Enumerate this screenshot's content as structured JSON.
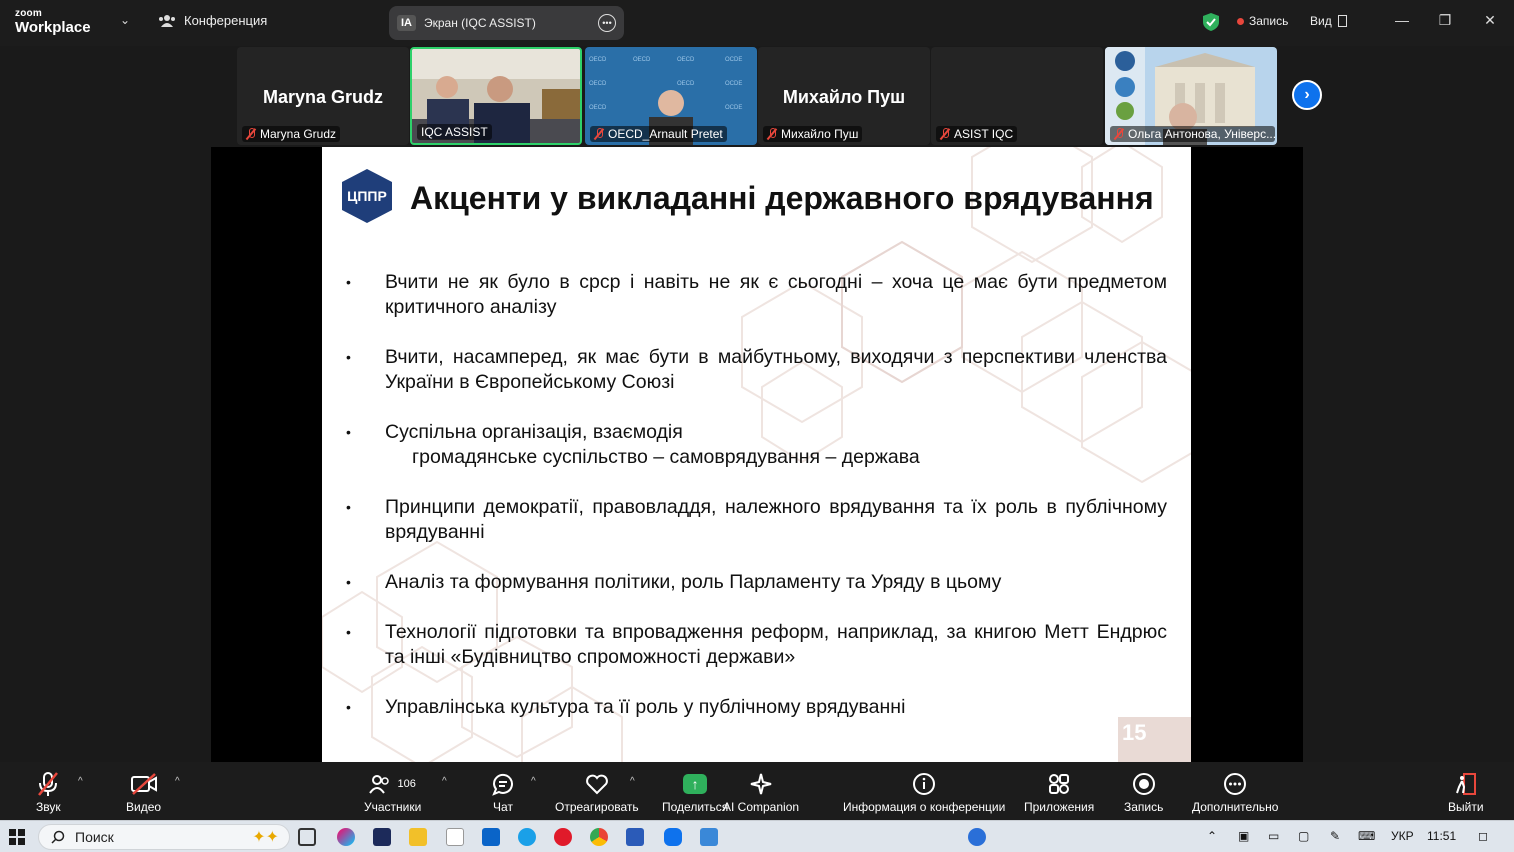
{
  "topbar": {
    "logo_small": "zoom",
    "logo_big": "Workplace",
    "conference_label": "Конференция",
    "screen_badge": "IA",
    "screen_label": "Экран (IQC ASSIST)",
    "record_label": "Запись",
    "view_label": "Вид",
    "accent_green": "#2fb05c",
    "record_color": "#e8473c"
  },
  "participants": [
    {
      "big_name": "Maryna Grudz",
      "label": "Maryna Grudz",
      "muted": true,
      "video": false
    },
    {
      "big_name": "",
      "label": "IQC ASSIST",
      "muted": false,
      "video": true,
      "active": true
    },
    {
      "big_name": "",
      "label": "OECD_Arnault Pretet",
      "muted": true,
      "video": true
    },
    {
      "big_name": "Михайло Пуш",
      "label": "Михайло Пуш",
      "muted": true,
      "video": false
    },
    {
      "big_name": "",
      "label": "ASIST IQC",
      "muted": true,
      "video": false
    },
    {
      "big_name": "",
      "label": "Ольга Антонова, Універс...",
      "muted": true,
      "video": true
    }
  ],
  "slide": {
    "logo_text": "ЦППР",
    "title": "Акценти у викладанні державного врядування",
    "bullets": [
      {
        "text": "Вчити не як було в срср і навіть не як є сьогодні – хоча це має бути предметом критичного аналізу",
        "sub": ""
      },
      {
        "text": "Вчити, насамперед, як має бути в майбутньому, виходячи з перспективи членства України в Європейському Союзі",
        "sub": ""
      },
      {
        "text": "Суспільна організація, взаємодія",
        "sub": "громадянське суспільство – самоврядування – держава"
      },
      {
        "text": "Принципи демократії, правовладдя, належного врядування та їх роль в публічному врядуванні",
        "sub": ""
      },
      {
        "text": "Аналіз та формування політики, роль Парламенту та Уряду в цьому",
        "sub": ""
      },
      {
        "text": "Технології підготовки та впровадження реформ, наприклад, за книгою Метт Ендрюс та інші «Будівництво спроможності держави»",
        "sub": ""
      },
      {
        "text": "Управлінська культура та її роль у публічному врядуванні",
        "sub": ""
      }
    ],
    "page_number": "15",
    "brand_color": "#1f3e7a"
  },
  "toolbar": {
    "audio": "Звук",
    "video": "Видео",
    "participants": "Участники",
    "participants_count": "106",
    "chat": "Чат",
    "react": "Отреагировать",
    "share": "Поделиться",
    "ai_companion": "AI Companion",
    "info": "Информация о конференции",
    "apps": "Приложения",
    "record": "Запись",
    "more": "Дополнительно",
    "leave": "Выйти"
  },
  "taskbar": {
    "search_label": "Поиск",
    "language": "УКР",
    "time": "11:51"
  }
}
